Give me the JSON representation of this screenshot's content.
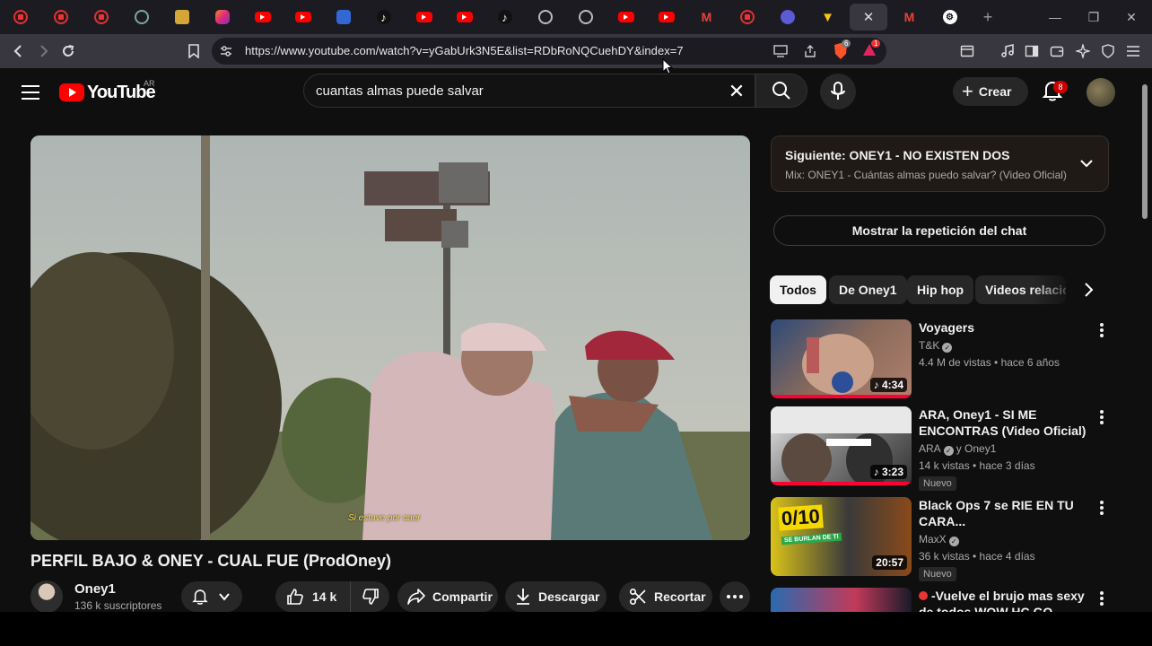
{
  "browser": {
    "tabs": [
      {
        "icon": "youtube-ring-icon"
      },
      {
        "icon": "youtube-ring-icon"
      },
      {
        "icon": "youtube-ring-icon"
      },
      {
        "icon": "globe-icon"
      },
      {
        "icon": "gift-icon"
      },
      {
        "icon": "instagram-icon"
      },
      {
        "icon": "youtube-icon"
      },
      {
        "icon": "youtube-icon"
      },
      {
        "icon": "blue-app-icon"
      },
      {
        "icon": "tiktok-icon"
      },
      {
        "icon": "youtube-icon"
      },
      {
        "icon": "youtube-icon"
      },
      {
        "icon": "tiktok-icon"
      },
      {
        "icon": "globe-icon"
      },
      {
        "icon": "globe-icon"
      },
      {
        "icon": "youtube-icon"
      },
      {
        "icon": "youtube-icon"
      },
      {
        "icon": "gmail-icon"
      },
      {
        "icon": "youtube-ring-icon"
      },
      {
        "icon": "ai-assistant-icon"
      },
      {
        "icon": "vivaldi-icon"
      },
      {
        "icon": "close-icon",
        "active": true
      },
      {
        "icon": "gmail-icon"
      },
      {
        "icon": "steam-icon"
      }
    ],
    "url": "https://www.youtube.com/watch?v=yGabUrk3N5E&list=RDbRoNQCuehDY&index=7",
    "shields_badge": "6",
    "rewards_badge": "1"
  },
  "header": {
    "logo_text": "YouTube",
    "country_code": "AR",
    "search_query": "cuantas almas puede salvar",
    "create_label": "Crear",
    "notification_count": "8"
  },
  "video": {
    "subtitle": "Si estuve por caer",
    "title": "PERFIL BAJO & ONEY - CUAL FUE (ProdOney)",
    "channel": "Oney1",
    "subscribers": "136 k suscriptores",
    "likes": "14 k",
    "share_label": "Compartir",
    "download_label": "Descargar",
    "clip_label": "Recortar"
  },
  "sidebar": {
    "next_title": "Siguiente: ONEY1 - NO EXISTEN DOS",
    "next_subtitle": "Mix: ONEY1 - Cuántas almas puedo salvar? (Video Oficial)",
    "chat_replay_label": "Mostrar la repetición del chat",
    "chips": [
      "Todos",
      "De Oney1",
      "Hip hop",
      "Videos relacio"
    ],
    "recommendations": [
      {
        "title": "Voyagers",
        "channel": "T&K",
        "stats": "4.4 M de vistas • hace 6 años",
        "duration": "4:34",
        "music": true,
        "badge": ""
      },
      {
        "title": "ARA, Oney1 - SI ME ENCONTRAS (Video Oficial)",
        "channel": "ARA",
        "channel_extra": "y Oney1",
        "stats": "14 k vistas • hace 3 días",
        "duration": "3:23",
        "music": true,
        "badge": "Nuevo"
      },
      {
        "title": "Black Ops 7 se RIE EN TU CARA...",
        "channel": "MaxX",
        "stats": "36 k vistas • hace 4 días",
        "duration": "20:57",
        "music": false,
        "badge": "Nuevo"
      },
      {
        "title": "-Vuelve el brujo mas sexy de todos WOW HC GO Again",
        "channel": "",
        "stats": "",
        "duration": "",
        "music": false,
        "badge": ""
      }
    ],
    "thumb_text_3": "0/10",
    "thumb_text_3b": "SE BURLAN DE TI"
  },
  "colors": {
    "accent": "#ff0000",
    "background": "#0f0f0f",
    "chip": "#272727"
  }
}
